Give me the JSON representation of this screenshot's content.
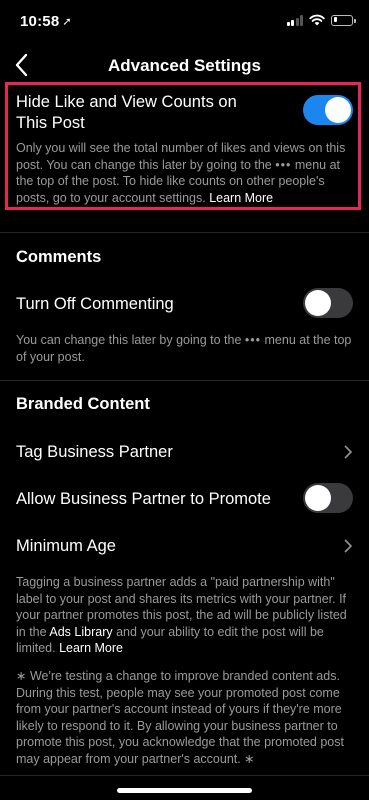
{
  "status": {
    "time": "10:58",
    "location_arrow": "➚"
  },
  "nav": {
    "title": "Advanced Settings"
  },
  "hide_counts": {
    "title_line1": "Hide Like and View Counts on",
    "title_line2": "This Post",
    "enabled": true,
    "desc_part1": "Only you will see the total number of likes and views on this post. You can change this later by going to the",
    "menu_dots": "•••",
    "desc_part2": "menu at the top of the post. To hide like counts on other people's posts, go to your account settings.",
    "learn_more": "Learn More"
  },
  "comments": {
    "section_title": "Comments",
    "turn_off_label": "Turn Off Commenting",
    "enabled": false,
    "desc_part1": "You can change this later by going to the",
    "menu_dots": "•••",
    "desc_part2": "menu at the top of your post."
  },
  "branded": {
    "section_title": "Branded Content",
    "tag_partner_label": "Tag Business Partner",
    "allow_promote_label": "Allow Business Partner to Promote",
    "allow_promote_enabled": false,
    "min_age_label": "Minimum Age",
    "desc_part1": "Tagging a business partner adds a \"paid partnership with\" label to your post and shares its metrics with your partner. If your partner promotes this post, the ad will be publicly listed in the",
    "ads_library": "Ads Library",
    "desc_part2": "and your ability to edit the post will be limited.",
    "learn_more": "Learn More",
    "testing_note": "∗ We're testing a change to improve branded content ads. During this test, people may see your promoted post come from your partner's account instead of yours if they're more likely to respond to it. By allowing your business partner to promote this post, you acknowledge that the promoted post may appear from your partner's account. ∗"
  }
}
